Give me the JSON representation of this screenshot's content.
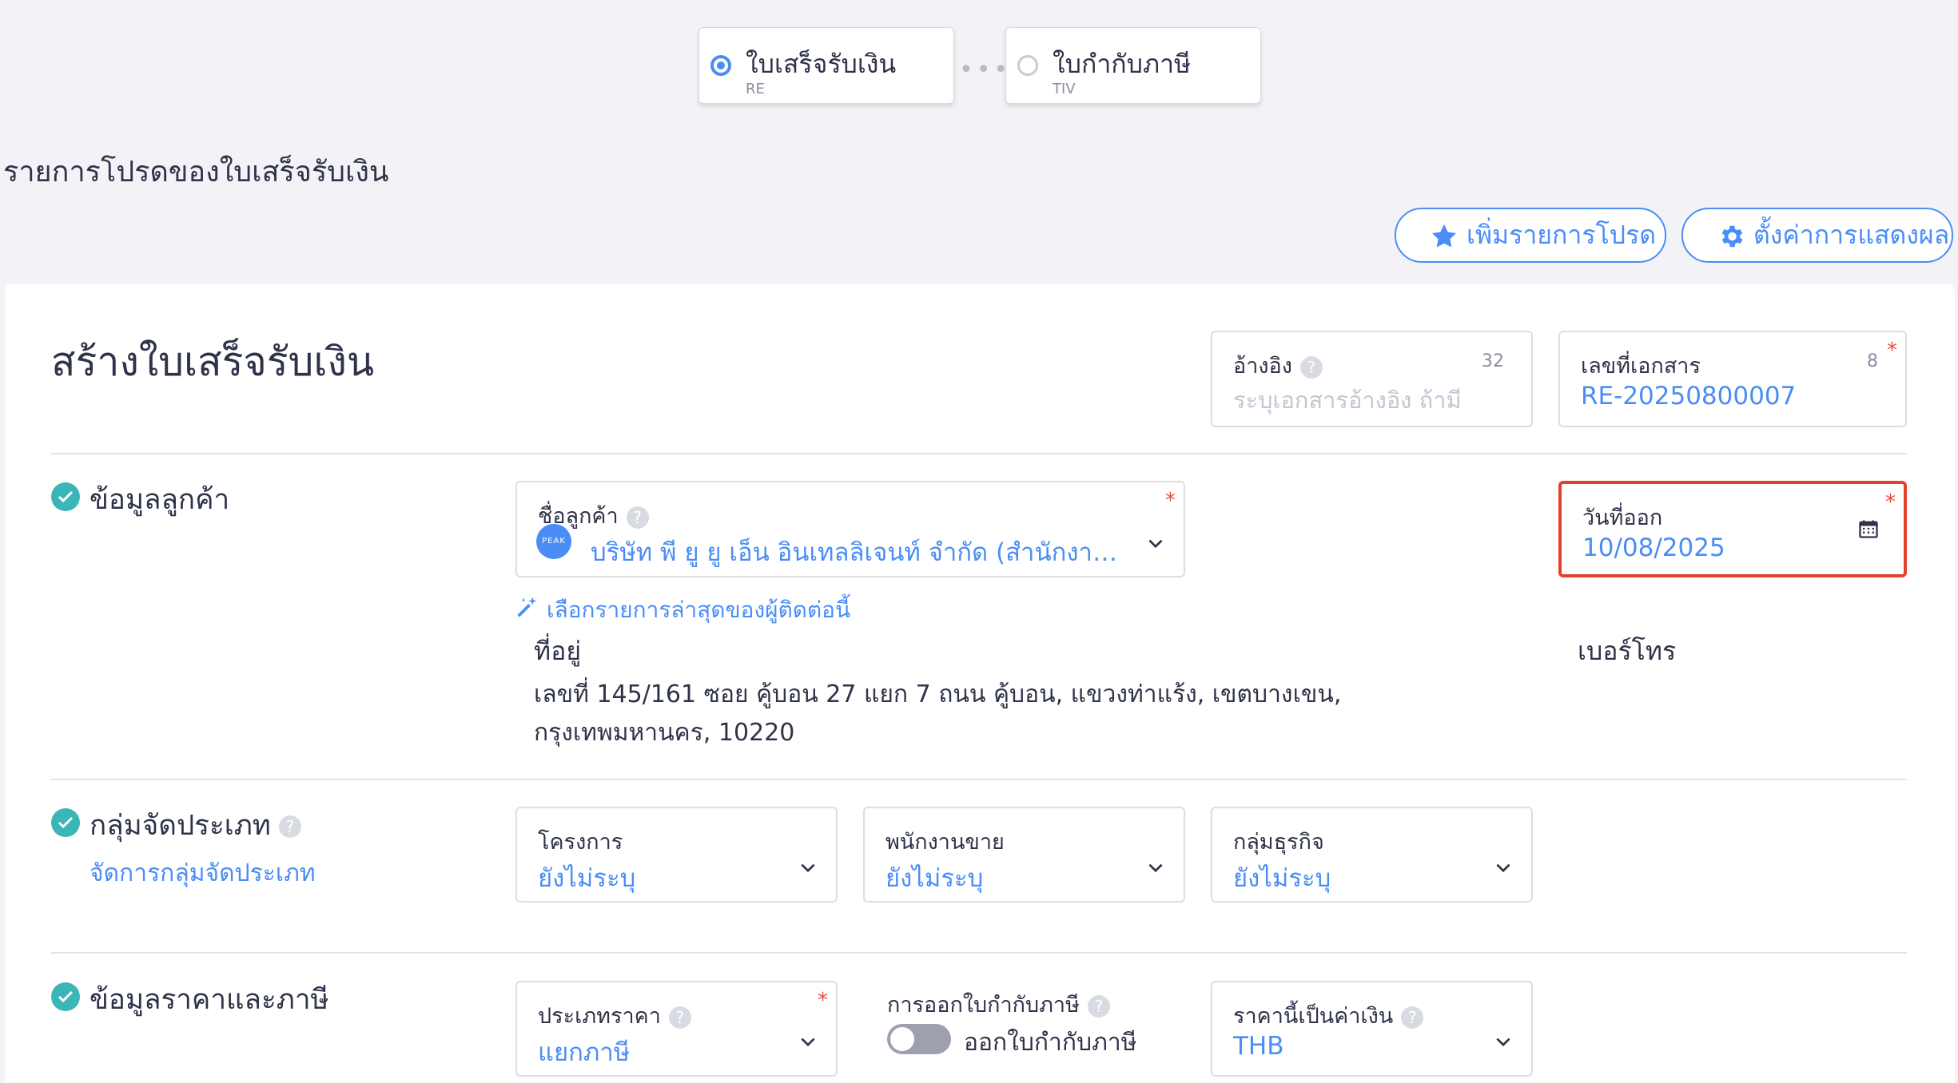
{
  "stepper": {
    "steps": [
      {
        "label": "ใบเสร็จรับเงิน",
        "code": "RE",
        "active": true
      },
      {
        "label": "ใบกำกับภาษี",
        "code": "TIV",
        "active": false
      }
    ],
    "separator": "•••"
  },
  "favorites": {
    "title": "รายการโปรดของใบเสร็จรับเงิน",
    "add_favorite_label": "เพิ่มรายการโปรด",
    "display_settings_label": "ตั้งค่าการแสดงผล"
  },
  "page": {
    "title": "สร้างใบเสร็จรับเงิน"
  },
  "reference": {
    "label": "อ้างอิง",
    "help": "?",
    "count": "32",
    "placeholder": "ระบุเอกสารอ้างอิง ถ้ามี"
  },
  "document_number": {
    "label": "เลขที่เอกสาร",
    "count": "8",
    "required": "*",
    "value": "RE-20250800007"
  },
  "customer_section": {
    "title": "ข้อมูลลูกค้า",
    "customer_name_label": "ชื่อลูกค้า",
    "customer_name_help": "?",
    "required": "*",
    "avatar_text": "PEAK",
    "customer_name_value": "บริษัท พี ยู ยู เอ็น อินเทลลิเจนท์ จำกัด (สำนักงานให...",
    "recent_link": "เลือกรายการล่าสุดของผู้ติดต่อนี้",
    "address_label": "ที่อยู่",
    "address_value": "เลขที่ 145/161 ซอย คู้บอน 27 แยก 7 ถนน คู้บอน, แขวงท่าแร้ง, เขตบางเขน, กรุงเทพมหานคร, 10220",
    "phone_label": "เบอร์โทร",
    "issue_date_label": "วันที่ออก",
    "issue_date_required": "*",
    "issue_date_value": "10/08/2025"
  },
  "category_section": {
    "title": "กลุ่มจัดประเภท",
    "help": "?",
    "manage_link": "จัดการกลุ่มจัดประเภท",
    "project_label": "โครงการ",
    "project_value": "ยังไม่ระบุ",
    "salesperson_label": "พนักงานขาย",
    "salesperson_value": "ยังไม่ระบุ",
    "business_group_label": "กลุ่มธุรกิจ",
    "business_group_value": "ยังไม่ระบุ"
  },
  "price_section": {
    "title": "ข้อมูลราคาและภาษี",
    "price_type_label": "ประเภทราคา",
    "price_type_help": "?",
    "price_type_required": "*",
    "price_type_value": "แยกภาษี",
    "tax_invoice_label": "การออกใบกำกับภาษี",
    "tax_invoice_help": "?",
    "tax_invoice_toggle_label": "ออกใบกำกับภาษี",
    "currency_label": "ราคานี้เป็นค่าเงิน",
    "currency_help": "?",
    "currency_value": "THB"
  },
  "colors": {
    "accent": "#4a8df6",
    "check": "#3ab5b8",
    "required": "#e74c3c",
    "highlight": "#e1412f"
  }
}
